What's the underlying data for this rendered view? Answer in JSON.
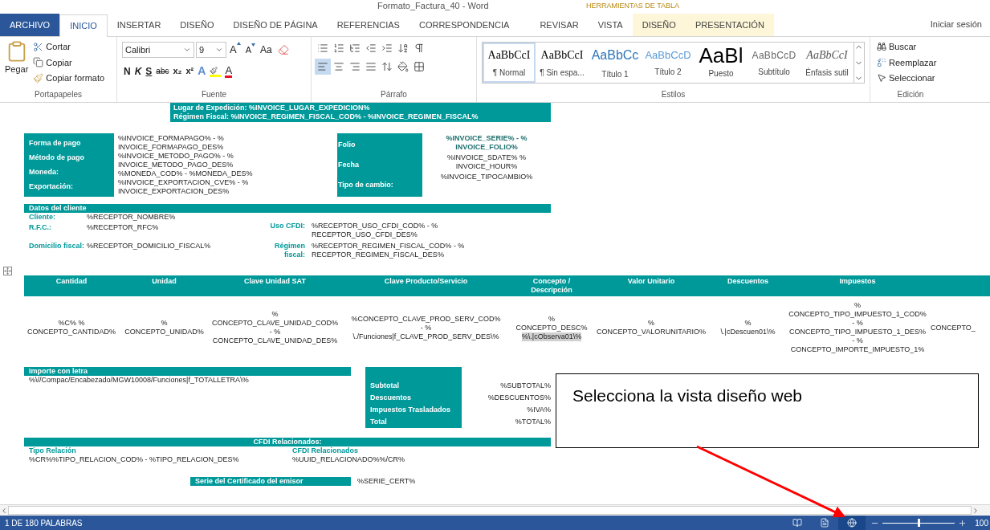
{
  "title_bar": {
    "title": "Formato_Factura_40 - Word",
    "context_label": "HERRAMIENTAS DE TABLA"
  },
  "tabs": [
    {
      "label": "ARCHIVO",
      "kind": "file",
      "selected": false
    },
    {
      "label": "INICIO",
      "kind": "normal",
      "selected": true
    },
    {
      "label": "INSERTAR",
      "kind": "normal",
      "selected": false
    },
    {
      "label": "DISEÑO",
      "kind": "normal",
      "selected": false
    },
    {
      "label": "DISEÑO DE PÁGINA",
      "kind": "normal",
      "selected": false
    },
    {
      "label": "REFERENCIAS",
      "kind": "normal",
      "selected": false
    },
    {
      "label": "CORRESPONDENCIA",
      "kind": "normal",
      "selected": false
    },
    {
      "label": "REVISAR",
      "kind": "normal",
      "selected": false
    },
    {
      "label": "VISTA",
      "kind": "normal",
      "selected": false
    },
    {
      "label": "DISEÑO",
      "kind": "context",
      "selected": false
    },
    {
      "label": "PRESENTACIÓN",
      "kind": "context",
      "selected": false
    }
  ],
  "account": "Iniciar sesión",
  "clipboard": {
    "paste": "Pegar",
    "cut": "Cortar",
    "copy": "Copiar",
    "format_painter": "Copiar formato",
    "label": "Portapapeles"
  },
  "font": {
    "family": "Calibri",
    "size": "9",
    "grow": "A",
    "shrink": "A",
    "case": "Aa",
    "bold": "N",
    "italic": "K",
    "underline": "S",
    "strike": "abc",
    "subscript": "x₂",
    "superscript": "x²",
    "effects": "A",
    "font_color_letter": "A",
    "label": "Fuente"
  },
  "paragraph": {
    "label": "Párrafo"
  },
  "styles": {
    "label": "Estilos",
    "items": [
      {
        "preview": "AaBbCcI",
        "name": "¶ Normal",
        "kind": "serif",
        "selected": true
      },
      {
        "preview": "AaBbCcI",
        "name": "¶ Sin espa...",
        "kind": "serif",
        "selected": false
      },
      {
        "preview": "AaBbCc",
        "name": "Título 1",
        "kind": "heading1",
        "selected": false
      },
      {
        "preview": "AaBbCcD",
        "name": "Título 2",
        "kind": "heading2",
        "selected": false
      },
      {
        "preview": "AaBl",
        "name": "Puesto",
        "kind": "title",
        "selected": false
      },
      {
        "preview": "AaBbCcD",
        "name": "Subtítulo",
        "kind": "subtitle",
        "selected": false
      },
      {
        "preview": "AaBbCcI",
        "name": "Énfasis sutil",
        "kind": "emphasis",
        "selected": false
      }
    ]
  },
  "editing": {
    "label": "Edición",
    "find": "Buscar",
    "replace": "Reemplazar",
    "select": "Seleccionar"
  },
  "header_box": [
    "Lugar de Expedición: %INVOICE_LUGAR_EXPEDICION%",
    "Régimen Fiscal: %INVOICE_REGIMEN_FISCAL_COD% - %INVOICE_REGIMEN_FISCAL%"
  ],
  "payment": {
    "left": [
      {
        "label": "Forma de pago",
        "value": [
          "%INVOICE_FORMAPAGO% -  %",
          "INVOICE_FORMAPAGO_DES%"
        ]
      },
      {
        "label": "Método de pago",
        "value": [
          "%INVOICE_METODO_PAGO% -  %",
          "INVOICE_METODO_PAGO_DES%"
        ]
      },
      {
        "label": "Moneda:",
        "value": [
          "%MONEDA_COD% - %MONEDA_DES%"
        ]
      },
      {
        "label": "Exportación:",
        "value": [
          "%INVOICE_EXPORTACION_CVE% - %",
          "INVOICE_EXPORTACION_DES%"
        ]
      }
    ],
    "right": [
      {
        "label": "Folio",
        "value": [
          "%INVOICE_SERIE% - %",
          "INVOICE_FOLIO%"
        ],
        "bold": true
      },
      {
        "label": "Fecha",
        "value": [
          "%INVOICE_SDATE% %",
          "INVOICE_HOUR%"
        ],
        "bold": false
      },
      {
        "label": "Tipo de cambio:",
        "value": [
          "%INVOICE_TIPOCAMBIO%"
        ],
        "bold": false
      }
    ]
  },
  "client": {
    "title": "Datos del cliente",
    "left": [
      {
        "label": "Cliente:",
        "value": [
          "%RECEPTOR_NOMBRE%"
        ]
      },
      {
        "label": "R.F.C.:",
        "value": [
          "%RECEPTOR_RFC%"
        ]
      },
      {
        "label": "Domicilio fiscal:",
        "value": [
          "%RECEPTOR_DOMICILIO_FISCAL%"
        ]
      }
    ],
    "right": [
      {
        "label": "Uso CFDI:",
        "value": [
          "%RECEPTOR_USO_CFDI_COD% - %",
          "RECEPTOR_USO_CFDI_DES%"
        ]
      },
      {
        "label": "Régimen fiscal:",
        "value": [
          "%RECEPTOR_REGIMEN_FISCAL_COD% - %",
          "RECEPTOR_REGIMEN_FISCAL_DES%"
        ]
      }
    ]
  },
  "concepts": {
    "columns": [
      "Cantidad",
      "Unidad",
      "Clave Unidad SAT",
      "Clave Producto/Servicio",
      "Concepto / Descripción",
      "Valor Unitario",
      "Descuentos",
      "Impuestos"
    ],
    "row": [
      [
        {
          "text": "%C% %",
          "highlighted": false
        },
        {
          "text": "CONCEPTO_CANTIDAD%",
          "highlighted": false
        }
      ],
      [
        {
          "text": "%",
          "highlighted": false
        },
        {
          "text": "CONCEPTO_UNIDAD%",
          "highlighted": false
        }
      ],
      [
        {
          "text": "%",
          "highlighted": false
        },
        {
          "text": "CONCEPTO_CLAVE_UNIDAD_COD%",
          "highlighted": false
        },
        {
          "text": "- %",
          "highlighted": false
        },
        {
          "text": "CONCEPTO_CLAVE_UNIDAD_DES%",
          "highlighted": false
        }
      ],
      [
        {
          "text": "%CONCEPTO_CLAVE_PROD_SERV_COD%",
          "highlighted": false
        },
        {
          "text": "- %",
          "highlighted": false
        },
        {
          "text": "\\./Funciones|f_CLAVE_PROD_SERV_DES\\%",
          "highlighted": false
        }
      ],
      [
        {
          "text": "%",
          "highlighted": false
        },
        {
          "text": "CONCEPTO_DESC%",
          "highlighted": false
        },
        {
          "text": "%\\.|cObserva01\\%",
          "highlighted": true
        }
      ],
      [
        {
          "text": "%",
          "highlighted": false
        },
        {
          "text": "CONCEPTO_VALORUNITARIO%",
          "highlighted": false
        }
      ],
      [
        {
          "text": "%",
          "highlighted": false
        },
        {
          "text": "\\.|cDescuen01\\%",
          "highlighted": false
        }
      ],
      [
        {
          "text": "%",
          "highlighted": false
        },
        {
          "text": "CONCEPTO_TIPO_IMPUESTO_1_COD%",
          "highlighted": false
        },
        {
          "text": "- %",
          "highlighted": false
        },
        {
          "text": "CONCEPTO_TIPO_IMPUESTO_1_DES%",
          "highlighted": false
        },
        {
          "text": "- %",
          "highlighted": false
        },
        {
          "text": "CONCEPTO_IMPORTE_IMPUESTO_1%",
          "highlighted": false
        }
      ],
      [
        {
          "text": "CONCEPTO_",
          "highlighted": false
        }
      ]
    ]
  },
  "amount_words": {
    "title": "Importe con letra",
    "value": "%\\//Compac/Encabezado/MGW10008/Funciones|f_TOTALLETRA\\%"
  },
  "totals": [
    {
      "label": "Subtotal",
      "value": "%SUBTOTAL%"
    },
    {
      "label": "Descuentos",
      "value": "%DESCUENTOS%"
    },
    {
      "label": "Impuestos Trasladados",
      "value": "%IVA%"
    },
    {
      "label": "Total",
      "value": "%TOTAL%"
    }
  ],
  "related": {
    "title": "CFDI Relacionados:",
    "columns": [
      {
        "label": "Tipo Relación",
        "value": "%CR%%TIPO_RELACION_COD% - %TIPO_RELACION_DES%"
      },
      {
        "label": "CFDI Relacionados",
        "value": "%UUID_RELACIONADO%%/CR%"
      }
    ]
  },
  "certificate": {
    "label": "Serie del Certificado del emisor",
    "value": "%SERIE_CERT%"
  },
  "callout": "Selecciona la vista diseño web",
  "status_bar": {
    "words": "1 DE 180 PALABRAS",
    "views": [
      {
        "kind": "read",
        "selected": false
      },
      {
        "kind": "print",
        "selected": false
      },
      {
        "kind": "web",
        "selected": true
      }
    ],
    "zoom": {
      "level": 0.5,
      "reading": "100"
    }
  }
}
